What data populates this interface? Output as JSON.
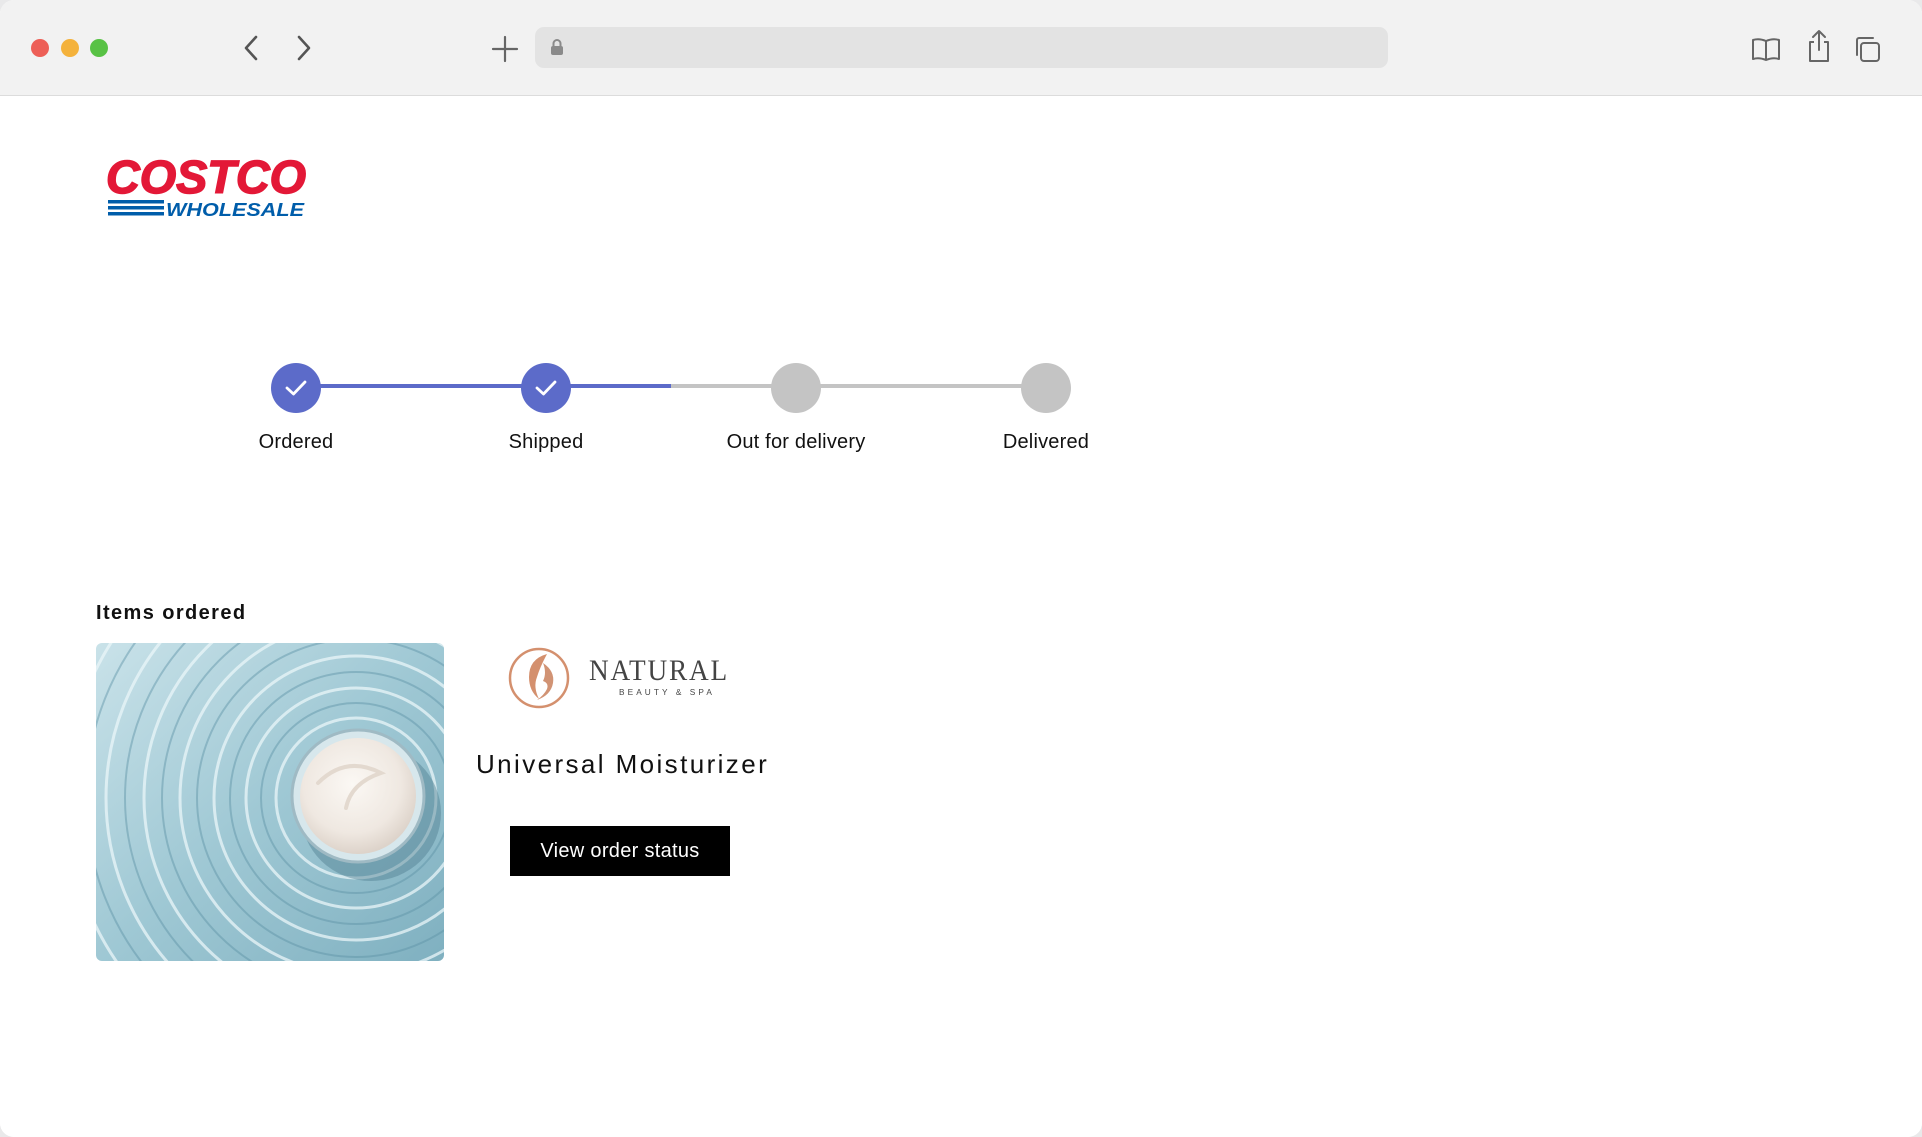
{
  "browser": {
    "address_bar_text": "",
    "icons": [
      "back-arrow-icon",
      "forward-arrow-icon",
      "plus-icon",
      "lock-icon",
      "reader-icon",
      "share-icon",
      "tabs-icon"
    ]
  },
  "logo": {
    "line1": "COSTCO",
    "line2": "WHOLESALE",
    "colors": {
      "red": "#e31837",
      "blue": "#005daa"
    }
  },
  "tracker": {
    "steps": [
      {
        "label": "Ordered",
        "status": "complete"
      },
      {
        "label": "Shipped",
        "status": "complete"
      },
      {
        "label": "Out for delivery",
        "status": "pending"
      },
      {
        "label": "Delivered",
        "status": "pending"
      }
    ],
    "colors": {
      "complete": "#5c6bc9",
      "pending": "#c4c4c4"
    }
  },
  "items": {
    "heading": "Items ordered",
    "product": {
      "brand_name": "NATURAL",
      "brand_tagline": "BEAUTY & SPA",
      "name": "Universal Moisturizer",
      "button_label": "View order status"
    }
  }
}
